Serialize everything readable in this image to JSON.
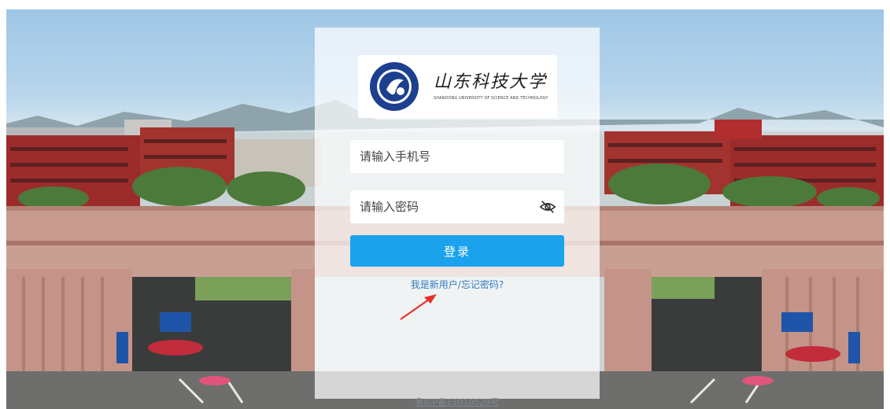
{
  "logo": {
    "name_cn": "山东科技大学",
    "name_en": "SHANDONG UNIVERSITY OF SCIENCE AND TECHNOLOGY"
  },
  "login": {
    "phone_placeholder": "请输入手机号",
    "password_placeholder": "请输入密码",
    "password_toggle_icon": "eye-off-icon",
    "submit_label": "登录",
    "register_link": "我是新用户/忘记密码?"
  },
  "footer": {
    "icp": "鲁ICP备15010529号"
  },
  "colors": {
    "primary": "#1aa3ec",
    "link": "#2f7bc1",
    "annotation_arrow": "#e8302a"
  }
}
